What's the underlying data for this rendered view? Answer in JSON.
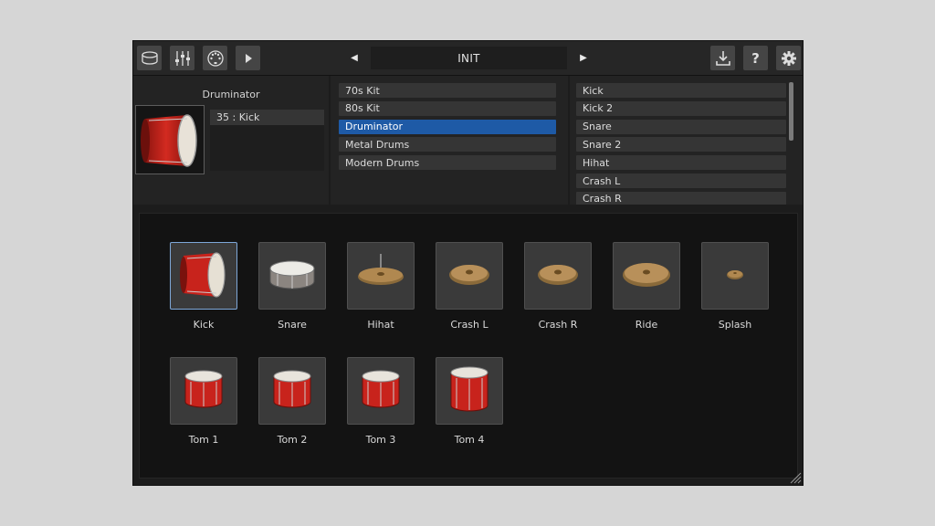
{
  "toolbar": {
    "preset_name": "INIT",
    "prev_arrow": "◀",
    "next_arrow": "▶"
  },
  "kit_panel": {
    "kit_name": "Druminator",
    "note": "35 : Kick"
  },
  "kits": [
    {
      "label": "70s Kit",
      "selected": false
    },
    {
      "label": "80s Kit",
      "selected": false
    },
    {
      "label": "Druminator",
      "selected": true
    },
    {
      "label": "Metal Drums",
      "selected": false
    },
    {
      "label": "Modern Drums",
      "selected": false
    }
  ],
  "instruments": [
    {
      "label": "Kick"
    },
    {
      "label": "Kick 2"
    },
    {
      "label": "Snare"
    },
    {
      "label": "Snare 2"
    },
    {
      "label": "Hihat"
    },
    {
      "label": "Crash L"
    },
    {
      "label": "Crash R"
    }
  ],
  "pads": [
    {
      "label": "Kick",
      "kind": "kick",
      "selected": true
    },
    {
      "label": "Snare",
      "kind": "snare",
      "selected": false
    },
    {
      "label": "Hihat",
      "kind": "hihat",
      "selected": false
    },
    {
      "label": "Crash L",
      "kind": "cymbal",
      "selected": false
    },
    {
      "label": "Crash R",
      "kind": "cymbal",
      "selected": false
    },
    {
      "label": "Ride",
      "kind": "cymbal-large",
      "selected": false
    },
    {
      "label": "Splash",
      "kind": "splash",
      "selected": false
    },
    {
      "label": "Tom 1",
      "kind": "tom",
      "selected": false
    },
    {
      "label": "Tom 2",
      "kind": "tom",
      "selected": false
    },
    {
      "label": "Tom 3",
      "kind": "tom",
      "selected": false
    },
    {
      "label": "Tom 4",
      "kind": "floor-tom",
      "selected": false
    }
  ],
  "colors": {
    "accent": "#1e5aa6",
    "drum_red": "#c8231c"
  }
}
